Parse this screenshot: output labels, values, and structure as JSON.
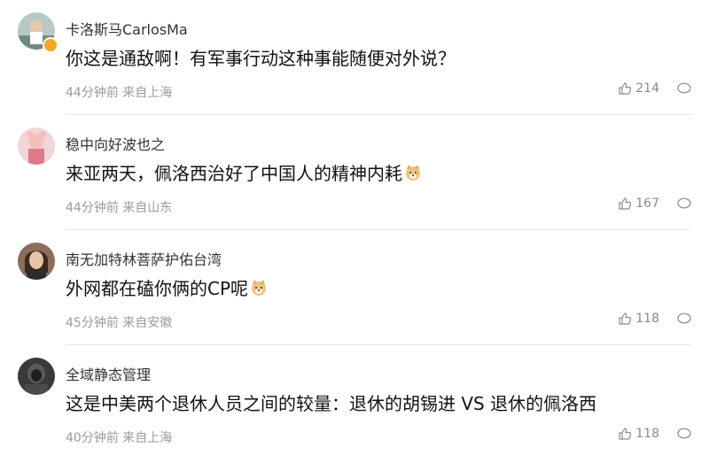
{
  "comments": [
    {
      "username": "卡洛斯马CarlosMa",
      "content": "你这是通敌啊！有军事行动这种事能随便对外说？",
      "time": "44分钟前",
      "location": "来自上海",
      "likes": "214",
      "verified": true,
      "has_emoji": false
    },
    {
      "username": "稳中向好波也之",
      "content": "来亚两天，佩洛西治好了中国人的精神内耗",
      "time": "44分钟前",
      "location": "来自山东",
      "likes": "167",
      "verified": false,
      "has_emoji": true
    },
    {
      "username": "南无加特林菩萨护佑台湾",
      "content": "外网都在磕你俩的CP呢",
      "time": "45分钟前",
      "location": "来自安徽",
      "likes": "118",
      "verified": false,
      "has_emoji": true
    },
    {
      "username": "全域静态管理",
      "content": "这是中美两个退休人员之间的较量：退休的胡锡进 VS 退休的佩洛西",
      "time": "40分钟前",
      "location": "来自上海",
      "likes": "118",
      "verified": false,
      "has_emoji": false
    }
  ],
  "icons": {
    "like": "thumbs-up-icon",
    "reply": "comment-bubble-icon",
    "emoji": "doge-emoji-icon",
    "verified": "verified-badge-icon"
  },
  "colors": {
    "meta_text": "#9a9a9a",
    "username_text": "#333333",
    "verified_badge": "#f5a623"
  }
}
